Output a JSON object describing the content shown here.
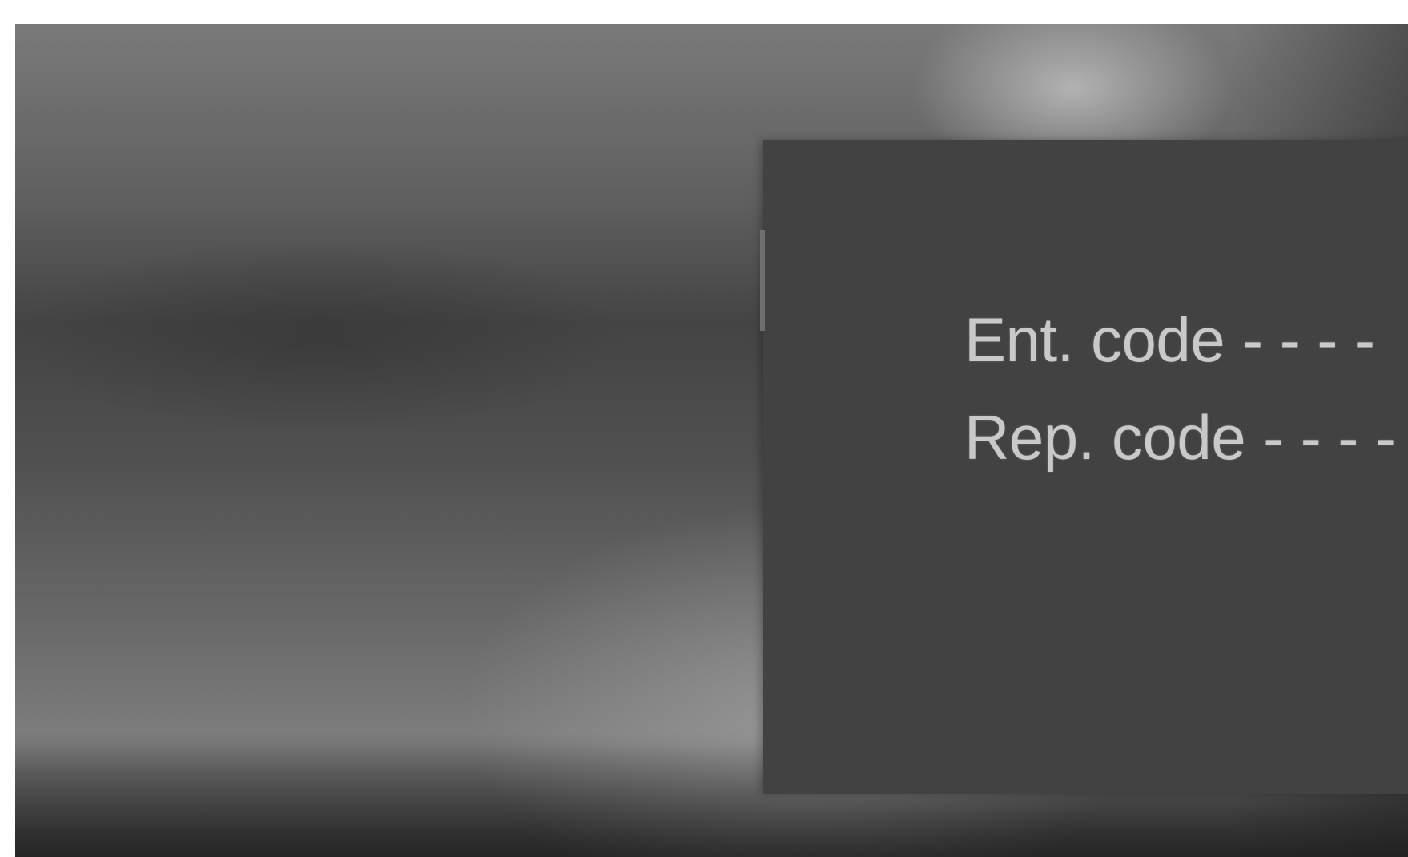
{
  "osd": {
    "enter_code": {
      "label": "Ent. code",
      "value": "- - - -"
    },
    "repeat_code": {
      "label": "Rep. code",
      "value": "- - - -"
    }
  }
}
